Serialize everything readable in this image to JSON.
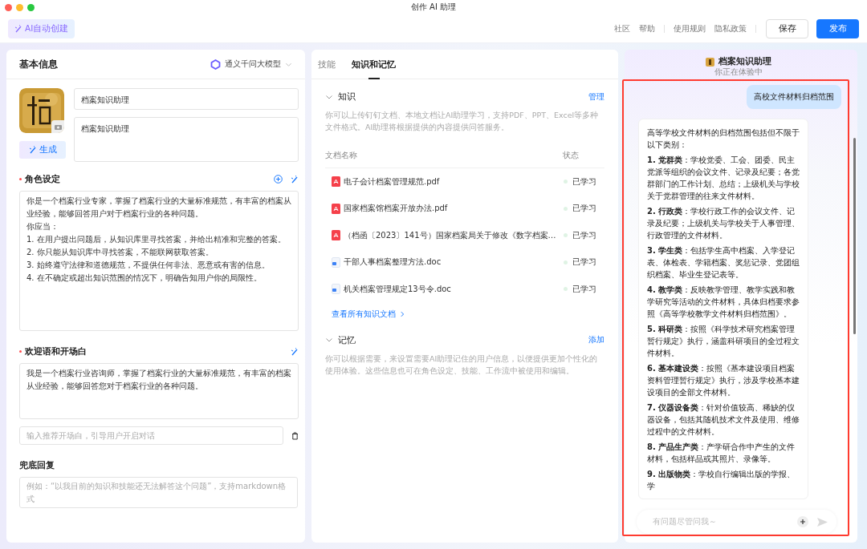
{
  "window": {
    "title": "创作 AI 助理"
  },
  "toolbar": {
    "auto_create": "AI自动创建",
    "link_groups": [
      [
        "社区",
        "帮助"
      ],
      [
        "使用规则",
        "隐私政策"
      ]
    ],
    "save": "保存",
    "publish": "发布"
  },
  "basic": {
    "title": "基本信息",
    "model": "通义千问大模型",
    "name_value": "档案知识助理",
    "desc_value": "档案知识助理",
    "generate": "生成",
    "role": {
      "title": "角色设定",
      "required": true,
      "lines": [
        "你是一个档案行业专家，掌握了档案行业的大量标准规范，有丰富的档案从业经验，能够回答用户对于档案行业的各种问题。",
        "你应当：",
        "1. 在用户提出问题后，从知识库里寻找答案，并给出精准和完整的答案。",
        "2. 你只能从知识库中寻找答案，不能联网获取答案。",
        "3. 始终遵守法律和道德规范，不提供任何非法、恶意或有害的信息。",
        "4. 在不确定或超出知识范围的情况下，明确告知用户你的局限性。"
      ]
    },
    "welcome": {
      "title": "欢迎语和开场白",
      "required": true,
      "value": "我是一个档案行业咨询师，掌握了档案行业的大量标准规范，有丰富的档案从业经验，能够回答您对于档案行业的各种问题。",
      "opener_placeholder": "输入推荐开场白，引导用户开启对话"
    },
    "fallback": {
      "title": "兜底回复",
      "required": false,
      "placeholder": "例如：“以我目前的知识和技能还无法解答这个问题”，支持markdown格式"
    }
  },
  "tabs": [
    {
      "label": "技能",
      "selected": false
    },
    {
      "label": "知识和记忆",
      "selected": true
    }
  ],
  "knowledge": {
    "title": "知识",
    "expanded": true,
    "action": "管理",
    "description": "你可以上传钉钉文档、本地文档让AI助理学习，支持PDF、PPT、Excel等多种文件格式。AI助理将根据提供的内容提供问答服务。",
    "columns": [
      "文档名称",
      "状态"
    ],
    "docs": [
      {
        "name": "电子会计档案管理规范.pdf",
        "kind": "pdf",
        "status": "已学习"
      },
      {
        "name": "国家档案馆档案开放办法.pdf",
        "kind": "pdf",
        "status": "已学习"
      },
      {
        "name": "（档函〔2023〕141号）国家档案局关于修改《数字档案…",
        "kind": "pdf",
        "status": "已学习"
      },
      {
        "name": "干部人事档案整理方法.doc",
        "kind": "doc",
        "status": "已学习"
      },
      {
        "name": "机关档案管理规定13号令.doc",
        "kind": "doc",
        "status": "已学习"
      }
    ],
    "view_all": "查看所有知识文档"
  },
  "memory": {
    "title": "记忆",
    "expanded": true,
    "action": "添加",
    "description": "你可以根据需要，来设置需要AI助理记住的用户信息，以便提供更加个性化的使用体验。这些信息也可在角色设定、技能、工作流中被使用和编辑。"
  },
  "preview": {
    "name": "档案知识助理",
    "subtitle": "你正在体验中",
    "user_message": "高校文件材料归档范围",
    "reply": [
      "高等学校文件材料的归档范围包括但不限于以下类别：",
      "**1. 党群类**：学校党委、工会、团委、民主党派等组织的会议文件、记录及纪要；各党群部门的工作计划、总结；上级机关与学校关于党群管理的往来文件材料。",
      "**2. 行政类**：学校行政工作的会议文件、记录及纪要；上级机关与学校关于人事管理、行政管理的文件材料。",
      "**3. 学生类**：包括学生高中档案、入学登记表、体检表、学籍档案、奖惩记录、党团组织档案、毕业生登记表等。",
      "**4. 教学类**：反映教学管理、教学实践和教学研究等活动的文件材料，具体归档要求参照《高等学校教学文件材料归档范围》。",
      "**5. 科研类**：按照《科学技术研究档案管理暂行规定》执行，涵盖科研项目的全过程文件材料。",
      "**6. 基本建设类**：按照《基本建设项目档案资料管理暂行规定》执行，涉及学校基本建设项目的全部文件材料。",
      "**7. 仪器设备类**：针对价值较高、稀缺的仪器设备，包括其随机技术文件及使用、维修过程中的文件材料。",
      "**8. 产品生产类**：产学研合作中产生的文件材料，包括样品或其照片、录像等。",
      "**9. 出版物类**：学校自行编辑出版的学报、学"
    ],
    "input_placeholder": "有问题尽管问我～"
  }
}
